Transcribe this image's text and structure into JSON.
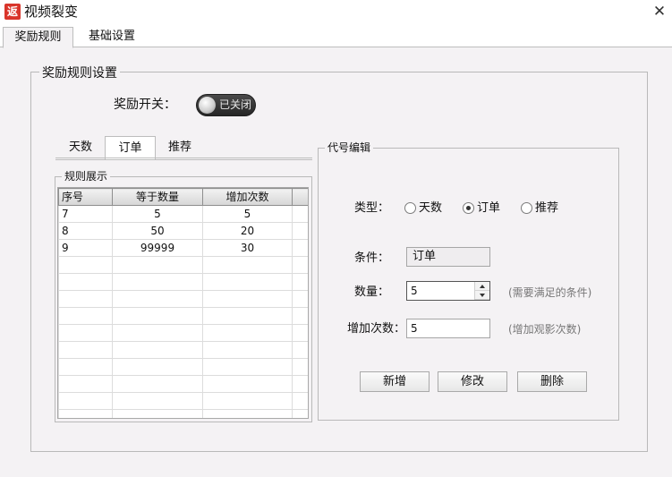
{
  "window": {
    "icon_text": "返",
    "title": "视频裂变",
    "close_glyph": "✕"
  },
  "tabs": [
    {
      "label": "奖励规则",
      "active": true
    },
    {
      "label": "基础设置",
      "active": false
    }
  ],
  "reward_group": {
    "legend": "奖励规则设置",
    "switch": {
      "label": "奖励开关：",
      "state_text": "已关闭",
      "on": false
    },
    "subtabs": [
      {
        "label": "天数"
      },
      {
        "label": "订单",
        "active": true
      },
      {
        "label": "推荐"
      }
    ],
    "rules_group": {
      "legend": "规则展示",
      "columns": [
        "序号",
        "等于数量",
        "增加次数"
      ],
      "rows": [
        [
          "7",
          "5",
          "5"
        ],
        [
          "8",
          "50",
          "20"
        ],
        [
          "9",
          "99999",
          "30"
        ]
      ]
    },
    "editor": {
      "legend": "代号编辑",
      "type_label": "类型：",
      "type_options": [
        {
          "label": "天数",
          "checked": false
        },
        {
          "label": "订单",
          "checked": true
        },
        {
          "label": "推荐",
          "checked": false
        }
      ],
      "condition_label": "条件：",
      "condition_value": "订单",
      "quantity_label": "数量：",
      "quantity_value": "5",
      "quantity_hint": "(需要满足的条件)",
      "increase_label": "增加次数：",
      "increase_value": "5",
      "increase_hint": "(增加观影次数)",
      "buttons": {
        "add": "新增",
        "modify": "修改",
        "delete": "删除"
      }
    }
  }
}
